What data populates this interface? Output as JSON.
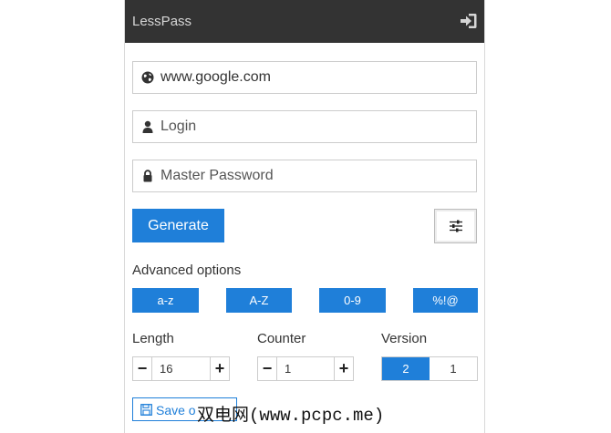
{
  "header": {
    "title": "LessPass",
    "signin_icon": "sign-in-icon",
    "background": "#333333"
  },
  "fields": {
    "site": {
      "value": "www.google.com",
      "icon": "globe-icon"
    },
    "login": {
      "placeholder": "Login",
      "icon": "user-icon"
    },
    "master_password": {
      "placeholder": "Master Password",
      "icon": "lock-icon"
    }
  },
  "actions": {
    "generate_label": "Generate",
    "options_icon": "sliders-icon"
  },
  "advanced": {
    "label": "Advanced options",
    "charsets": [
      "a-z",
      "A-Z",
      "0-9",
      "%!@"
    ]
  },
  "length": {
    "label": "Length",
    "value": "16",
    "minus": "−",
    "plus": "+"
  },
  "counter": {
    "label": "Counter",
    "value": "1",
    "minus": "−",
    "plus": "+"
  },
  "version": {
    "label": "Version",
    "options": [
      "2",
      "1"
    ],
    "selected": "2"
  },
  "save": {
    "label": "Save o",
    "icon": "floppy-icon"
  },
  "watermark": {
    "cjk": "双电网",
    "latin": "(www.pcpc.me)"
  },
  "colors": {
    "accent": "#1f7fd9",
    "header_bg": "#333333",
    "border": "#cccccc"
  }
}
